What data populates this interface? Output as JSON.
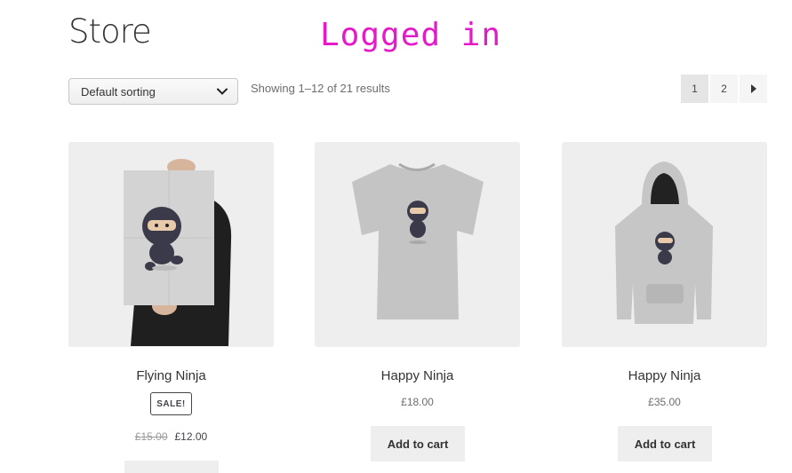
{
  "page": {
    "title": "Store"
  },
  "overlay": {
    "status": "Logged in"
  },
  "sorting": {
    "selected": "Default sorting"
  },
  "results": {
    "count_text": "Showing 1–12 of 21 results"
  },
  "pagination": {
    "pages": [
      "1",
      "2"
    ],
    "current": "1",
    "next_icon": "caret-right-icon"
  },
  "products": [
    {
      "name": "Flying Ninja",
      "image_icon": "ninja-poster-image",
      "badge": "SALE!",
      "old_price": "£15.00",
      "price": "£12.00",
      "on_sale": true
    },
    {
      "name": "Happy Ninja",
      "image_icon": "ninja-tshirt-image",
      "price": "£18.00",
      "action": "Add to cart"
    },
    {
      "name": "Happy Ninja",
      "image_icon": "ninja-hoodie-image",
      "price": "£35.00",
      "action": "Add to cart"
    }
  ],
  "colors": {
    "overlay_text": "#e619c8",
    "button_bg": "#eeeeee",
    "thumb_bg": "#eeeeee"
  }
}
